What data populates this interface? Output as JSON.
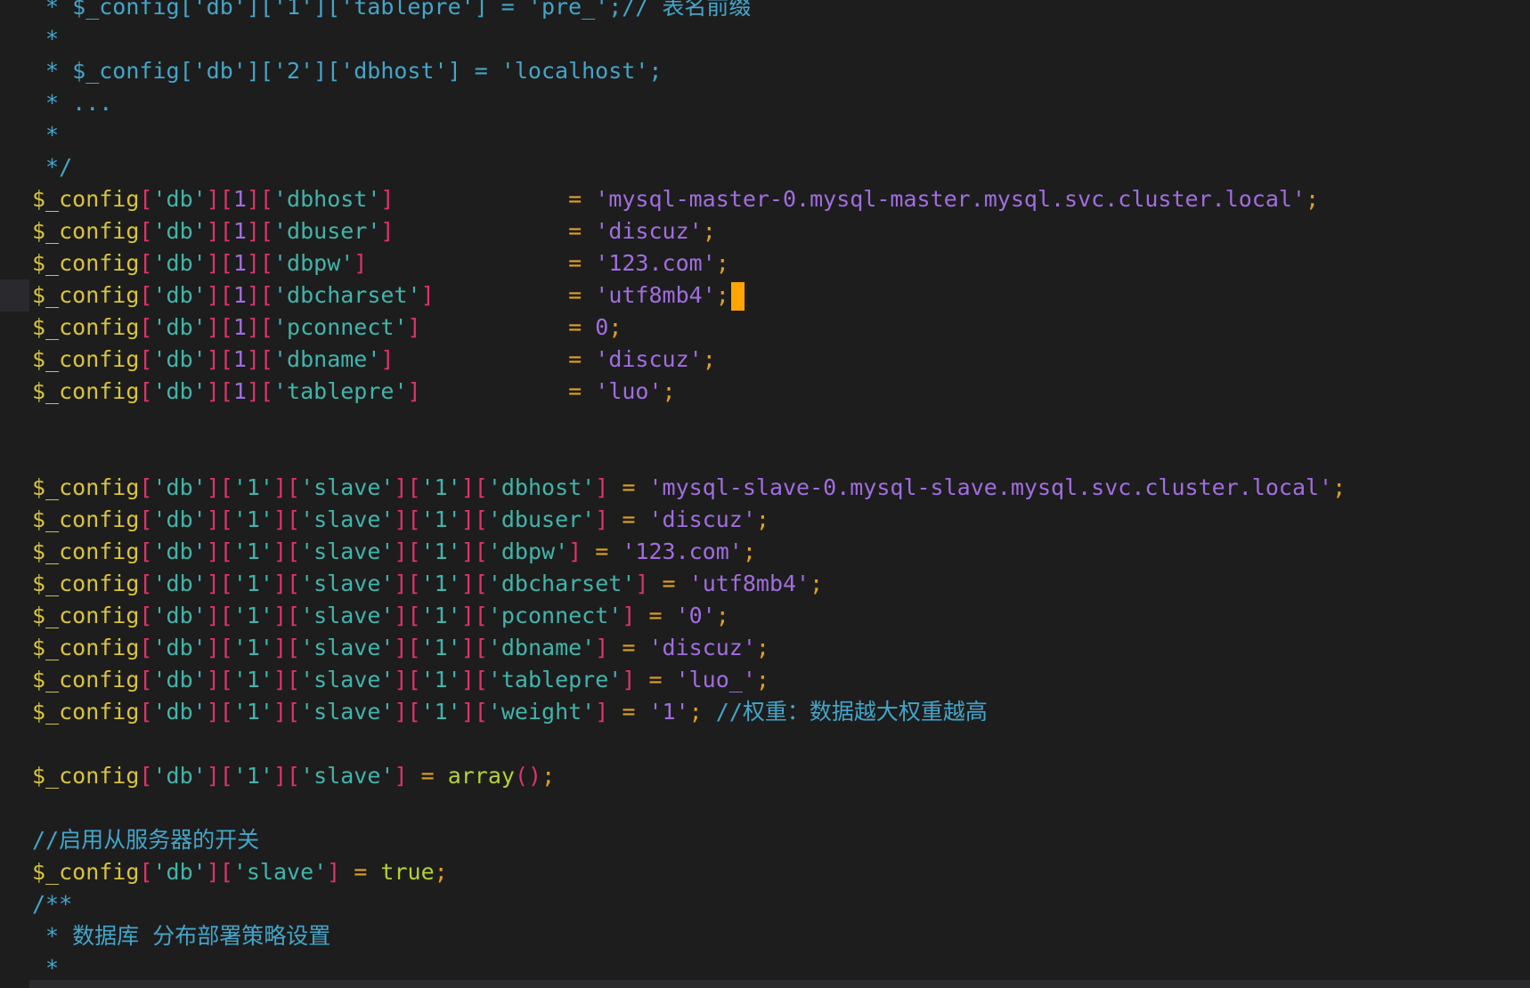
{
  "theme": {
    "background": "#1d1d1d",
    "comment": "#44a5c9",
    "variable": "#d7c43c",
    "bracket": "#e0336b",
    "key": "#41b5ab",
    "string": "#a06ee0",
    "operator": "#e0a020",
    "number": "#a06ee0",
    "function": "#b2d237",
    "keyword": "#b2d237",
    "default": "#cfcfcf",
    "cursor": "#ffa500"
  },
  "editor": {
    "cursor_line": 9,
    "lines": [
      [
        [
          "comment",
          " * $_config['db']['1']['tablepre'] = 'pre_';// 表名前缀"
        ]
      ],
      [
        [
          "comment",
          " *"
        ]
      ],
      [
        [
          "comment",
          " * $_config['db']['2']['dbhost'] = 'localhost';"
        ]
      ],
      [
        [
          "comment",
          " * ..."
        ]
      ],
      [
        [
          "comment",
          " *"
        ]
      ],
      [
        [
          "comment",
          " */"
        ]
      ],
      [
        [
          "variable",
          "$_config"
        ],
        [
          "bracket",
          "["
        ],
        [
          "key",
          "'db'"
        ],
        [
          "bracket",
          "]["
        ],
        [
          "number",
          "1"
        ],
        [
          "bracket",
          "]["
        ],
        [
          "key",
          "'dbhost'"
        ],
        [
          "bracket",
          "]"
        ],
        [
          "default",
          "             "
        ],
        [
          "operator",
          "="
        ],
        [
          "default",
          " "
        ],
        [
          "string",
          "'mysql-master-0.mysql-master.mysql.svc.cluster.local'"
        ],
        [
          "operator",
          ";"
        ]
      ],
      [
        [
          "variable",
          "$_config"
        ],
        [
          "bracket",
          "["
        ],
        [
          "key",
          "'db'"
        ],
        [
          "bracket",
          "]["
        ],
        [
          "number",
          "1"
        ],
        [
          "bracket",
          "]["
        ],
        [
          "key",
          "'dbuser'"
        ],
        [
          "bracket",
          "]"
        ],
        [
          "default",
          "             "
        ],
        [
          "operator",
          "="
        ],
        [
          "default",
          " "
        ],
        [
          "string",
          "'discuz'"
        ],
        [
          "operator",
          ";"
        ]
      ],
      [
        [
          "variable",
          "$_config"
        ],
        [
          "bracket",
          "["
        ],
        [
          "key",
          "'db'"
        ],
        [
          "bracket",
          "]["
        ],
        [
          "number",
          "1"
        ],
        [
          "bracket",
          "]["
        ],
        [
          "key",
          "'dbpw'"
        ],
        [
          "bracket",
          "]"
        ],
        [
          "default",
          "               "
        ],
        [
          "operator",
          "="
        ],
        [
          "default",
          " "
        ],
        [
          "string",
          "'123.com'"
        ],
        [
          "operator",
          ";"
        ]
      ],
      [
        [
          "variable",
          "$_config"
        ],
        [
          "bracket",
          "["
        ],
        [
          "key",
          "'db'"
        ],
        [
          "bracket",
          "]["
        ],
        [
          "number",
          "1"
        ],
        [
          "bracket",
          "]["
        ],
        [
          "key",
          "'dbcharset'"
        ],
        [
          "bracket",
          "]"
        ],
        [
          "default",
          "          "
        ],
        [
          "operator",
          "="
        ],
        [
          "default",
          " "
        ],
        [
          "string",
          "'utf8mb4'"
        ],
        [
          "operator",
          ";"
        ]
      ],
      [
        [
          "variable",
          "$_config"
        ],
        [
          "bracket",
          "["
        ],
        [
          "key",
          "'db'"
        ],
        [
          "bracket",
          "]["
        ],
        [
          "number",
          "1"
        ],
        [
          "bracket",
          "]["
        ],
        [
          "key",
          "'pconnect'"
        ],
        [
          "bracket",
          "]"
        ],
        [
          "default",
          "           "
        ],
        [
          "operator",
          "="
        ],
        [
          "default",
          " "
        ],
        [
          "number",
          "0"
        ],
        [
          "operator",
          ";"
        ]
      ],
      [
        [
          "variable",
          "$_config"
        ],
        [
          "bracket",
          "["
        ],
        [
          "key",
          "'db'"
        ],
        [
          "bracket",
          "]["
        ],
        [
          "number",
          "1"
        ],
        [
          "bracket",
          "]["
        ],
        [
          "key",
          "'dbname'"
        ],
        [
          "bracket",
          "]"
        ],
        [
          "default",
          "             "
        ],
        [
          "operator",
          "="
        ],
        [
          "default",
          " "
        ],
        [
          "string",
          "'discuz'"
        ],
        [
          "operator",
          ";"
        ]
      ],
      [
        [
          "variable",
          "$_config"
        ],
        [
          "bracket",
          "["
        ],
        [
          "key",
          "'db'"
        ],
        [
          "bracket",
          "]["
        ],
        [
          "number",
          "1"
        ],
        [
          "bracket",
          "]["
        ],
        [
          "key",
          "'tablepre'"
        ],
        [
          "bracket",
          "]"
        ],
        [
          "default",
          "           "
        ],
        [
          "operator",
          "="
        ],
        [
          "default",
          " "
        ],
        [
          "string",
          "'luo'"
        ],
        [
          "operator",
          ";"
        ]
      ],
      [],
      [],
      [
        [
          "variable",
          "$_config"
        ],
        [
          "bracket",
          "["
        ],
        [
          "key",
          "'db'"
        ],
        [
          "bracket",
          "]["
        ],
        [
          "key",
          "'1'"
        ],
        [
          "bracket",
          "]["
        ],
        [
          "key",
          "'slave'"
        ],
        [
          "bracket",
          "]["
        ],
        [
          "key",
          "'1'"
        ],
        [
          "bracket",
          "]["
        ],
        [
          "key",
          "'dbhost'"
        ],
        [
          "bracket",
          "]"
        ],
        [
          "default",
          " "
        ],
        [
          "operator",
          "="
        ],
        [
          "default",
          " "
        ],
        [
          "string",
          "'mysql-slave-0.mysql-slave.mysql.svc.cluster.local'"
        ],
        [
          "operator",
          ";"
        ]
      ],
      [
        [
          "variable",
          "$_config"
        ],
        [
          "bracket",
          "["
        ],
        [
          "key",
          "'db'"
        ],
        [
          "bracket",
          "]["
        ],
        [
          "key",
          "'1'"
        ],
        [
          "bracket",
          "]["
        ],
        [
          "key",
          "'slave'"
        ],
        [
          "bracket",
          "]["
        ],
        [
          "key",
          "'1'"
        ],
        [
          "bracket",
          "]["
        ],
        [
          "key",
          "'dbuser'"
        ],
        [
          "bracket",
          "]"
        ],
        [
          "default",
          " "
        ],
        [
          "operator",
          "="
        ],
        [
          "default",
          " "
        ],
        [
          "string",
          "'discuz'"
        ],
        [
          "operator",
          ";"
        ]
      ],
      [
        [
          "variable",
          "$_config"
        ],
        [
          "bracket",
          "["
        ],
        [
          "key",
          "'db'"
        ],
        [
          "bracket",
          "]["
        ],
        [
          "key",
          "'1'"
        ],
        [
          "bracket",
          "]["
        ],
        [
          "key",
          "'slave'"
        ],
        [
          "bracket",
          "]["
        ],
        [
          "key",
          "'1'"
        ],
        [
          "bracket",
          "]["
        ],
        [
          "key",
          "'dbpw'"
        ],
        [
          "bracket",
          "]"
        ],
        [
          "default",
          " "
        ],
        [
          "operator",
          "="
        ],
        [
          "default",
          " "
        ],
        [
          "string",
          "'123.com'"
        ],
        [
          "operator",
          ";"
        ]
      ],
      [
        [
          "variable",
          "$_config"
        ],
        [
          "bracket",
          "["
        ],
        [
          "key",
          "'db'"
        ],
        [
          "bracket",
          "]["
        ],
        [
          "key",
          "'1'"
        ],
        [
          "bracket",
          "]["
        ],
        [
          "key",
          "'slave'"
        ],
        [
          "bracket",
          "]["
        ],
        [
          "key",
          "'1'"
        ],
        [
          "bracket",
          "]["
        ],
        [
          "key",
          "'dbcharset'"
        ],
        [
          "bracket",
          "]"
        ],
        [
          "default",
          " "
        ],
        [
          "operator",
          "="
        ],
        [
          "default",
          " "
        ],
        [
          "string",
          "'utf8mb4'"
        ],
        [
          "operator",
          ";"
        ]
      ],
      [
        [
          "variable",
          "$_config"
        ],
        [
          "bracket",
          "["
        ],
        [
          "key",
          "'db'"
        ],
        [
          "bracket",
          "]["
        ],
        [
          "key",
          "'1'"
        ],
        [
          "bracket",
          "]["
        ],
        [
          "key",
          "'slave'"
        ],
        [
          "bracket",
          "]["
        ],
        [
          "key",
          "'1'"
        ],
        [
          "bracket",
          "]["
        ],
        [
          "key",
          "'pconnect'"
        ],
        [
          "bracket",
          "]"
        ],
        [
          "default",
          " "
        ],
        [
          "operator",
          "="
        ],
        [
          "default",
          " "
        ],
        [
          "string",
          "'0'"
        ],
        [
          "operator",
          ";"
        ]
      ],
      [
        [
          "variable",
          "$_config"
        ],
        [
          "bracket",
          "["
        ],
        [
          "key",
          "'db'"
        ],
        [
          "bracket",
          "]["
        ],
        [
          "key",
          "'1'"
        ],
        [
          "bracket",
          "]["
        ],
        [
          "key",
          "'slave'"
        ],
        [
          "bracket",
          "]["
        ],
        [
          "key",
          "'1'"
        ],
        [
          "bracket",
          "]["
        ],
        [
          "key",
          "'dbname'"
        ],
        [
          "bracket",
          "]"
        ],
        [
          "default",
          " "
        ],
        [
          "operator",
          "="
        ],
        [
          "default",
          " "
        ],
        [
          "string",
          "'discuz'"
        ],
        [
          "operator",
          ";"
        ]
      ],
      [
        [
          "variable",
          "$_config"
        ],
        [
          "bracket",
          "["
        ],
        [
          "key",
          "'db'"
        ],
        [
          "bracket",
          "]["
        ],
        [
          "key",
          "'1'"
        ],
        [
          "bracket",
          "]["
        ],
        [
          "key",
          "'slave'"
        ],
        [
          "bracket",
          "]["
        ],
        [
          "key",
          "'1'"
        ],
        [
          "bracket",
          "]["
        ],
        [
          "key",
          "'tablepre'"
        ],
        [
          "bracket",
          "]"
        ],
        [
          "default",
          " "
        ],
        [
          "operator",
          "="
        ],
        [
          "default",
          " "
        ],
        [
          "string",
          "'luo_'"
        ],
        [
          "operator",
          ";"
        ]
      ],
      [
        [
          "variable",
          "$_config"
        ],
        [
          "bracket",
          "["
        ],
        [
          "key",
          "'db'"
        ],
        [
          "bracket",
          "]["
        ],
        [
          "key",
          "'1'"
        ],
        [
          "bracket",
          "]["
        ],
        [
          "key",
          "'slave'"
        ],
        [
          "bracket",
          "]["
        ],
        [
          "key",
          "'1'"
        ],
        [
          "bracket",
          "]["
        ],
        [
          "key",
          "'weight'"
        ],
        [
          "bracket",
          "]"
        ],
        [
          "default",
          " "
        ],
        [
          "operator",
          "="
        ],
        [
          "default",
          " "
        ],
        [
          "string",
          "'1'"
        ],
        [
          "operator",
          ";"
        ],
        [
          "default",
          " "
        ],
        [
          "comment",
          "//权重：数据越大权重越高"
        ]
      ],
      [],
      [
        [
          "variable",
          "$_config"
        ],
        [
          "bracket",
          "["
        ],
        [
          "key",
          "'db'"
        ],
        [
          "bracket",
          "]["
        ],
        [
          "key",
          "'1'"
        ],
        [
          "bracket",
          "]["
        ],
        [
          "key",
          "'slave'"
        ],
        [
          "bracket",
          "]"
        ],
        [
          "default",
          " "
        ],
        [
          "operator",
          "="
        ],
        [
          "default",
          " "
        ],
        [
          "function",
          "array"
        ],
        [
          "bracket",
          "()"
        ],
        [
          "operator",
          ";"
        ]
      ],
      [],
      [
        [
          "comment",
          "//启用从服务器的开关"
        ]
      ],
      [
        [
          "variable",
          "$_config"
        ],
        [
          "bracket",
          "["
        ],
        [
          "key",
          "'db'"
        ],
        [
          "bracket",
          "]["
        ],
        [
          "key",
          "'slave'"
        ],
        [
          "bracket",
          "]"
        ],
        [
          "default",
          " "
        ],
        [
          "operator",
          "="
        ],
        [
          "default",
          " "
        ],
        [
          "keyword",
          "true"
        ],
        [
          "operator",
          ";"
        ]
      ],
      [
        [
          "comment",
          "/**"
        ]
      ],
      [
        [
          "comment",
          " * 数据库 分布部署策略设置"
        ]
      ],
      [
        [
          "comment",
          " *"
        ]
      ]
    ]
  }
}
